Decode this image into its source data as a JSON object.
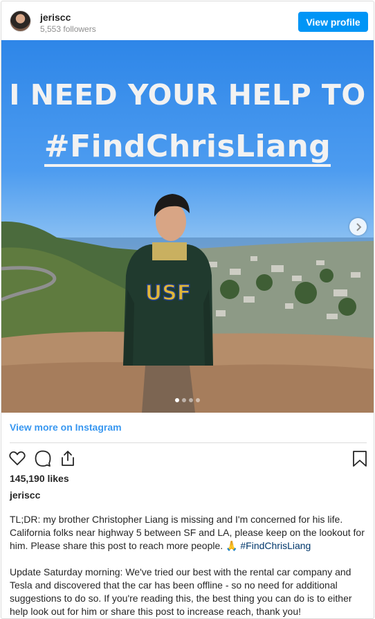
{
  "header": {
    "username": "jeriscc",
    "followers": "5,553 followers",
    "view_profile_label": "View profile"
  },
  "photo": {
    "headline_line1": "I NEED YOUR HELP TO",
    "headline_line2": "#FindChrisLiang",
    "sweatshirt_text": "USF",
    "carousel_dots": 4,
    "carousel_active": 1
  },
  "links": {
    "view_more": "View more on Instagram"
  },
  "stats": {
    "likes": "145,190 likes"
  },
  "caption": {
    "username": "jeriscc",
    "paragraph1": "TL;DR: my brother Christopher Liang is missing and I'm concerned for his life. California folks near highway 5 between SF and LA, please keep on the lookout for him. Please share this post to reach more people.",
    "emoji": "🙏",
    "hashtag": "#FindChrisLiang",
    "paragraph2": "Update Saturday morning: We've tried our best with the rental car company and Tesla and discovered that the car has been offline - so no need for additional suggestions to do so. If you're reading this, the best thing you can do is to either help look out for him or share this post to increase reach, thank you!"
  },
  "icons": {
    "like": "heart-icon",
    "comment": "comment-icon",
    "share": "share-icon",
    "save": "bookmark-icon",
    "next": "chevron-right-icon"
  },
  "colors": {
    "accent": "#0095f6",
    "link": "#3897f0",
    "hashtag": "#00376b"
  }
}
